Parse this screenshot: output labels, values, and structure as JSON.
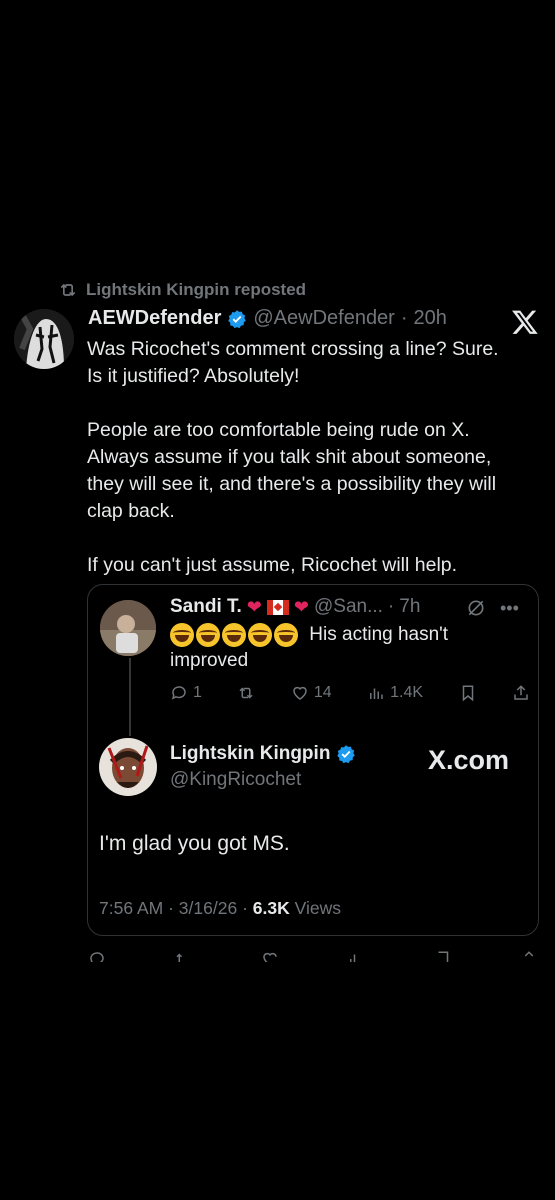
{
  "repost": {
    "label": "Lightskin Kingpin reposted",
    "icon": "repost-icon"
  },
  "post": {
    "display_name": "AEWDefender",
    "handle": "@AewDefender",
    "separator": "·",
    "time": "20h",
    "platform_icon": "x-logo-icon",
    "lines": [
      "Was Ricochet's comment crossing a line? Sure.",
      "Is it justified? Absolutely!",
      "People are too comfortable being rude on X.",
      "Always assume if you talk shit about someone,",
      "they will see it, and there's a possibility they will",
      "clap back.",
      "If you can't just assume, Ricochet will help."
    ]
  },
  "quoted": {
    "reply": {
      "display_name": "Sandi T.",
      "handle": "@San...",
      "separator": "·",
      "time": "7h",
      "text": "His acting hasn't improved",
      "stats": {
        "replies": "1",
        "likes": "14",
        "views": "1.4K"
      }
    },
    "tweet": {
      "display_name": "Lightskin Kingpin",
      "handle": "@KingRicochet",
      "watermark": "X.com",
      "text": "I'm glad you got MS.",
      "time": "7:56 AM",
      "separator": "·",
      "date": "3/16/26",
      "views_count": "6.3K",
      "views_label": "Views"
    }
  },
  "colors": {
    "background": "#000000",
    "text": "#e7e9ea",
    "muted": "#71767b",
    "verified": "#1d9bf0",
    "heart": "#e0245e"
  }
}
